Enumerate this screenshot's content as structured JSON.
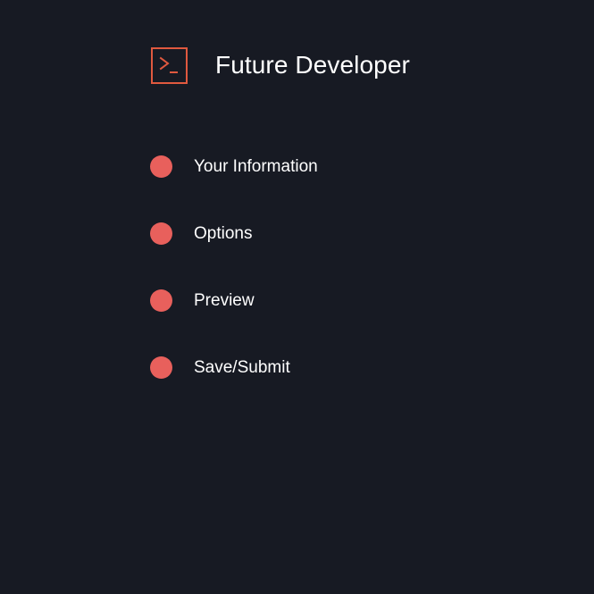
{
  "app": {
    "title": "Future Developer",
    "logo_icon": "terminal-prompt-icon",
    "accent_color": "#e0593f",
    "background_color": "#171a23"
  },
  "steps": {
    "dot_color": "#e8605c",
    "items": [
      {
        "label": "Your Information"
      },
      {
        "label": "Options"
      },
      {
        "label": "Preview"
      },
      {
        "label": "Save/Submit"
      }
    ]
  }
}
